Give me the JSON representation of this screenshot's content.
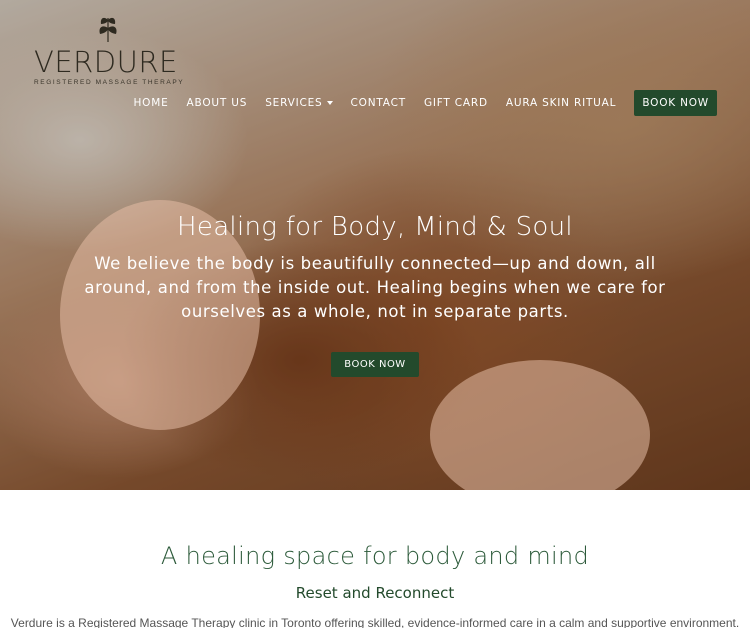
{
  "logo": {
    "icon": "leaf-icon",
    "name": "VERDURE",
    "tagline": "Registered Massage Therapy"
  },
  "nav": {
    "items": [
      {
        "label": "HOME"
      },
      {
        "label": "ABOUT US"
      },
      {
        "label": "SERVICES"
      },
      {
        "label": "CONTACT"
      },
      {
        "label": "GIFT CARD"
      },
      {
        "label": "AURA SKIN RITUAL"
      }
    ],
    "book_label": "BOOK NOW"
  },
  "hero": {
    "title": "Healing for Body, Mind & Soul",
    "text": "We believe the body is beautifully connected—up and down, all around, and from the inside out. Healing begins when we care for ourselves as a whole, not in separate parts.",
    "button_label": "BOOK NOW"
  },
  "intro": {
    "title": "A healing space for body and mind",
    "subtitle": "Reset and Reconnect",
    "text": "Verdure is a Registered Massage Therapy clinic in Toronto offering skilled, evidence-informed care in a calm and supportive environment."
  },
  "colors": {
    "brand_green": "#234a2c",
    "heading_green": "#2c5a3a"
  }
}
